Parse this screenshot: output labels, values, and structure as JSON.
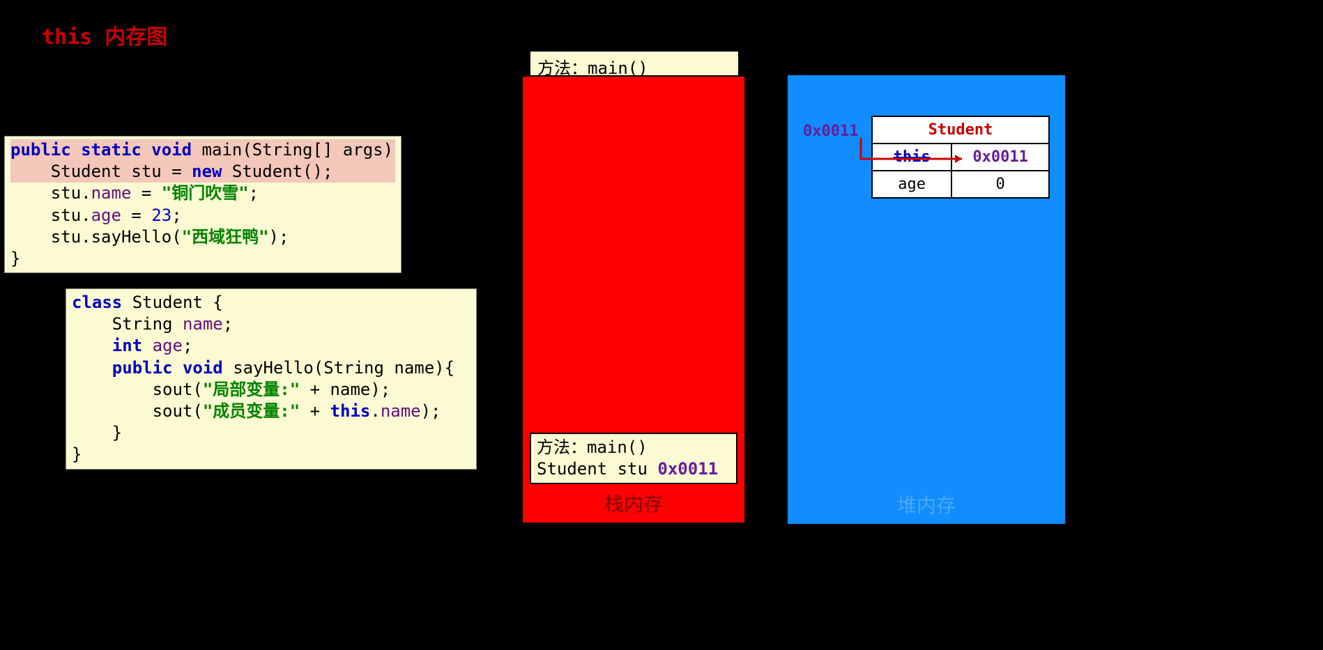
{
  "title": "this 内存图",
  "code1": {
    "l1a": "public static void",
    "l1b": " main(String[] args) {",
    "l2a": "    Student stu = ",
    "l2b": "new",
    "l2c": " Student();",
    "l3a": "    stu.",
    "l3b": "name",
    "l3c": " = ",
    "l3d": "\"铜门吹雪\"",
    "l3e": ";",
    "l4a": "    stu.",
    "l4b": "age",
    "l4c": " = ",
    "l4d": "23",
    "l4e": ";",
    "l5a": "    stu.sayHello(",
    "l5b": "\"西域狂鸭\"",
    "l5c": ");",
    "l6": "}"
  },
  "code2": {
    "l1a": "class",
    "l1b": " Student {",
    "l2a": "    String ",
    "l2b": "name",
    "l2c": ";",
    "l3a": "    ",
    "l3b": "int",
    "l3c": " ",
    "l3d": "age",
    "l3e": ";",
    "l4a": "    ",
    "l4b": "public void",
    "l4c": " sayHello(String name){",
    "l5a": "        sout(",
    "l5b": "\"局部变量:\"",
    "l5c": " + name);",
    "l6a": "        sout(",
    "l6b": "\"成员变量:\"",
    "l6c": " + ",
    "l6d": "this",
    "l6e": ".",
    "l6f": "name",
    "l6g": ");",
    "l7": "    }",
    "l8": "}"
  },
  "stack": {
    "top_label": "方法：main()",
    "frame_line1": "方法：main()",
    "frame_line2a": "Student stu  ",
    "frame_line2b": "0x0011",
    "caption": "栈内存"
  },
  "heap": {
    "addr_label": "0x0011",
    "obj_title": "Student",
    "row1_key": "this",
    "row1_val": "0x0011",
    "row2_key": "age",
    "row2_val": "0",
    "caption": "堆内存"
  }
}
